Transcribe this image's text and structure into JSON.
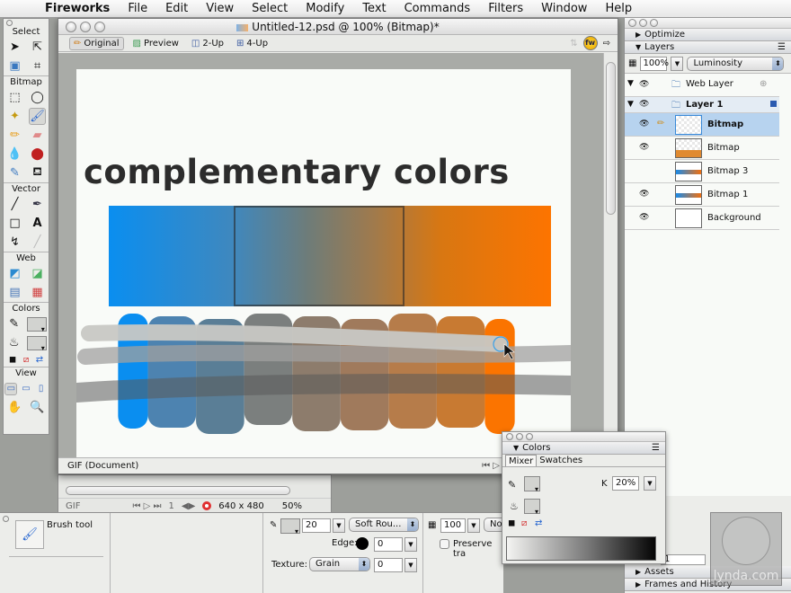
{
  "menubar": {
    "apple": "",
    "app_name": "Fireworks",
    "items": [
      "File",
      "Edit",
      "View",
      "Select",
      "Modify",
      "Text",
      "Commands",
      "Filters",
      "Window",
      "Help"
    ]
  },
  "tools_panel": {
    "sections": [
      "Select",
      "Bitmap",
      "Vector",
      "Web",
      "Colors",
      "View"
    ]
  },
  "document": {
    "title": "Untitled-12.psd @ 100% (Bitmap)*",
    "tabs": [
      {
        "label": "Original",
        "active": true
      },
      {
        "label": "Preview",
        "active": false
      },
      {
        "label": "2-Up",
        "active": false
      },
      {
        "label": "4-Up",
        "active": false
      }
    ],
    "heading_text": "complementary colors",
    "status_format": "GIF (Document)",
    "frame_number": "1",
    "size_readout": "640",
    "gradient_colors": {
      "start": "#0a8ef0",
      "middle": "#6e7c79",
      "end": "#fd7400"
    },
    "swatch_strokes": [
      "#0a8ef0",
      "#4d83b0",
      "#5a7e96",
      "#7b7f7e",
      "#8d7c6c",
      "#a07a5c",
      "#b67c4a",
      "#c87a32",
      "#fb7400"
    ]
  },
  "back_window": {
    "format": "GIF",
    "frame_number": "1",
    "dimensions": "640 x 480",
    "zoom": "50%"
  },
  "properties": {
    "tool_name": "Brush tool",
    "stroke_size": "20",
    "stroke_category": "Soft Rou...",
    "edge_label": "Edge:",
    "edge_value": "0",
    "texture_label": "Texture:",
    "texture_name": "Grain",
    "texture_value": "0",
    "opacity": "100",
    "blend_mode": "No",
    "preserve_transparency": "Preserve tra"
  },
  "dock": {
    "optimize_label": "Optimize",
    "layers_label": "Layers",
    "opacity": "100%",
    "blend_mode": "Luminosity",
    "layers": [
      {
        "name": "Web Layer",
        "type": "folder",
        "visible": true
      },
      {
        "name": "Layer 1",
        "type": "folder",
        "visible": true
      },
      {
        "name": "Bitmap",
        "type": "object",
        "visible": true,
        "selected": true,
        "editing": true
      },
      {
        "name": "Bitmap",
        "type": "object",
        "visible": true
      },
      {
        "name": "Bitmap 3",
        "type": "object",
        "visible": false
      },
      {
        "name": "Bitmap 1",
        "type": "object",
        "visible": true
      },
      {
        "name": "Background",
        "type": "object",
        "visible": true
      }
    ],
    "frame_select": "1",
    "assets_label": "Assets",
    "frames_history_label": "Frames and History"
  },
  "colors_panel": {
    "title": "Colors",
    "tabs": [
      "Mixer",
      "Swatches"
    ],
    "active_tab": "Mixer",
    "k_label": "K",
    "k_value": "20%"
  },
  "watermark": {
    "brand": "lynda.com"
  }
}
